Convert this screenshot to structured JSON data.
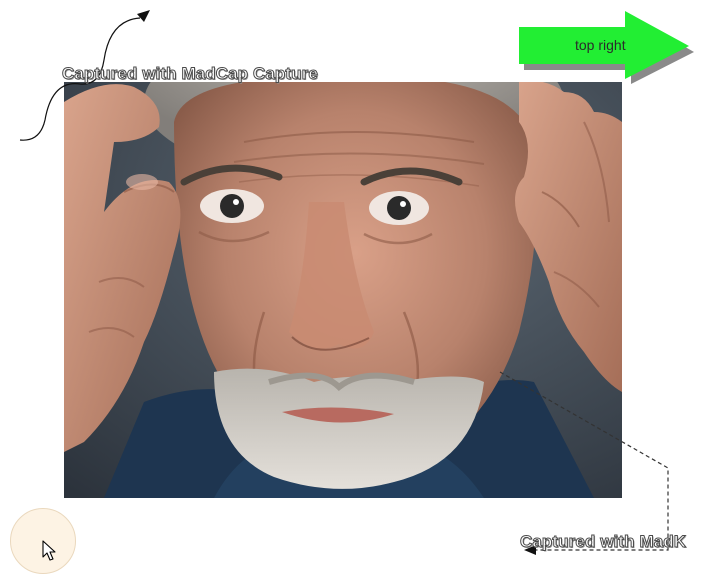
{
  "captions": {
    "top": "Captured with MadCap Capture",
    "bottom": "Captured with MadK"
  },
  "callout_arrow": {
    "label": "top right",
    "color": "#22ee33",
    "shadow_color": "#8a8a8a"
  },
  "photo": {
    "subject": "close-up portrait of an older man with hands raised beside his face",
    "background_color": "#3a4450"
  },
  "cursor": {
    "icon": "mouse-pointer-icon",
    "halo_color": "#fdf3e4"
  }
}
